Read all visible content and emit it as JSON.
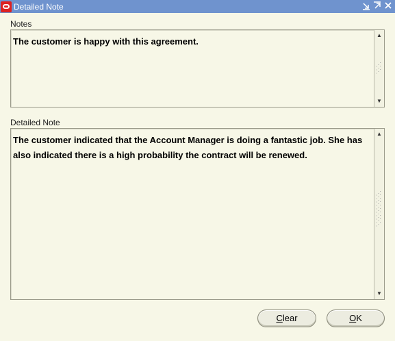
{
  "window": {
    "title": "Detailed Note",
    "controls": [
      "minimize-icon",
      "maximize-icon",
      "close-icon"
    ]
  },
  "notes": {
    "label": "Notes",
    "value": "The customer is happy with this agreement."
  },
  "detailed": {
    "label": "Detailed Note",
    "line1": "The customer indicated that the Account Manager is doing a fantastic job. She has",
    "line2": "also indicated there is a high probability the contract will be renewed."
  },
  "buttons": {
    "clear_first": "C",
    "clear_rest": "lear",
    "ok_first": "O",
    "ok_rest": "K"
  }
}
